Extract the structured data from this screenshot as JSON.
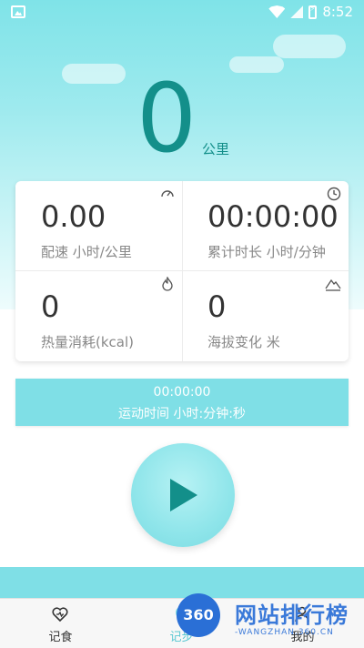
{
  "status_bar": {
    "time": "8:52"
  },
  "distance": {
    "value": "0",
    "unit": "公里"
  },
  "stats": [
    {
      "value": "0.00",
      "label": "配速  小时/公里",
      "icon": "speedometer-icon"
    },
    {
      "value": "00:00:00",
      "label": "累计时长  小时/分钟",
      "icon": "clock-icon"
    },
    {
      "value": "0",
      "label": "热量消耗(kcal)",
      "icon": "flame-icon"
    },
    {
      "value": "0",
      "label": "海拔变化 米",
      "icon": "mountain-icon"
    }
  ],
  "exercise_time": {
    "value": "00:00:00",
    "label": "运动时间 小时:分钟:秒"
  },
  "tabs": [
    {
      "label": "记食",
      "icon": "heart-icon"
    },
    {
      "label": "记步",
      "icon": "steps-icon"
    },
    {
      "label": "我的",
      "icon": "person-icon"
    }
  ],
  "watermark": {
    "badge": "360",
    "title": "网站排行榜",
    "subtitle": "-WANGZHAN.360.CN"
  },
  "colors": {
    "accent": "#138f8a",
    "cyan": "#7fdfe6"
  }
}
